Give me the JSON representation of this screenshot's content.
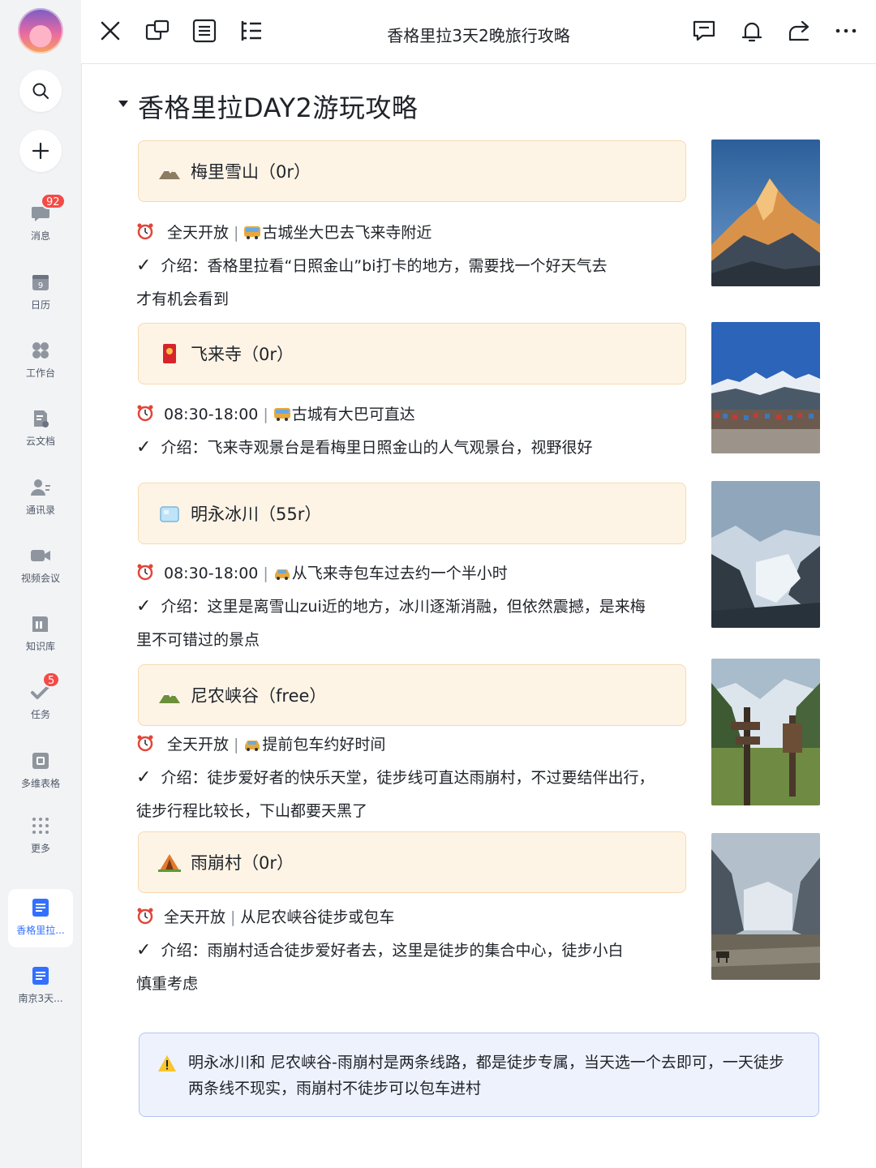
{
  "sidebar": {
    "message_badge": "92",
    "task_badge": "5",
    "items": [
      {
        "label": "消息"
      },
      {
        "label": "日历",
        "calendar_day": "9"
      },
      {
        "label": "工作台"
      },
      {
        "label": "云文档"
      },
      {
        "label": "通讯录"
      },
      {
        "label": "视频会议"
      },
      {
        "label": "知识库"
      },
      {
        "label": "任务"
      },
      {
        "label": "多维表格"
      },
      {
        "label": "更多"
      }
    ],
    "docs": [
      {
        "label": "香格里拉..."
      },
      {
        "label": "南京3天..."
      }
    ]
  },
  "topbar": {
    "title": "香格里拉3天2晚旅行攻略"
  },
  "heading": "香格里拉DAY2游玩攻略",
  "spots": [
    {
      "name": "梅里雪山（0r）",
      "icon": "mountain-icon",
      "time": "全天开放",
      "transport": "古城坐大巴去飞来寺附近",
      "intro_1": "介绍：香格里拉看“日照金山”bi打卡的地方，需要找一个好天气去",
      "intro_2": "才有机会看到"
    },
    {
      "name": "飞来寺（0r）",
      "icon": "red-envelope-icon",
      "time": "08:30-18:00",
      "transport": "古城有大巴可直达",
      "intro_1": "介绍：飞来寺观景台是看梅里日照金山的人气观景台，视野很好"
    },
    {
      "name": "明永冰川（55r）",
      "icon": "ice-icon",
      "time": "08:30-18:00",
      "transport": "从飞来寺包车过去约一个半小时",
      "intro_1": "介绍：这里是离雪山zui近的地方，冰川逐渐消融，但依然震撼，是来梅",
      "intro_2": "里不可错过的景点"
    },
    {
      "name": "尼农峡谷（free）",
      "icon": "mountain-icon",
      "time": "全天开放",
      "transport": "提前包车约好时间",
      "intro_1": "介绍：徒步爱好者的快乐天堂，徒步线可直达雨崩村，不过要结伴出行，",
      "intro_2": "徒步行程比较长，下山都要天黑了"
    },
    {
      "name": "雨崩村（0r）",
      "icon": "tent-icon",
      "time": "全天开放",
      "transport": "从尼农峡谷徒步或包车",
      "intro_1": "介绍：雨崩村适合徒步爱好者去，这里是徒步的集合中心，徒步小白",
      "intro_2": "慎重考虑"
    }
  ],
  "check_mark": "✓",
  "separator": "|",
  "warning": {
    "line_1": "明永冰川和 尼农峡谷-雨崩村是两条线路，都是徒步专属，当天选一个去即可，一天徒步",
    "line_2": "两条线不现实，雨崩村不徒步可以包车进村"
  },
  "colors": {
    "callout_bg": "#fef4e6",
    "warning_bg": "#eef2fc",
    "accent": "#3370ff",
    "badge": "#f54a45"
  }
}
